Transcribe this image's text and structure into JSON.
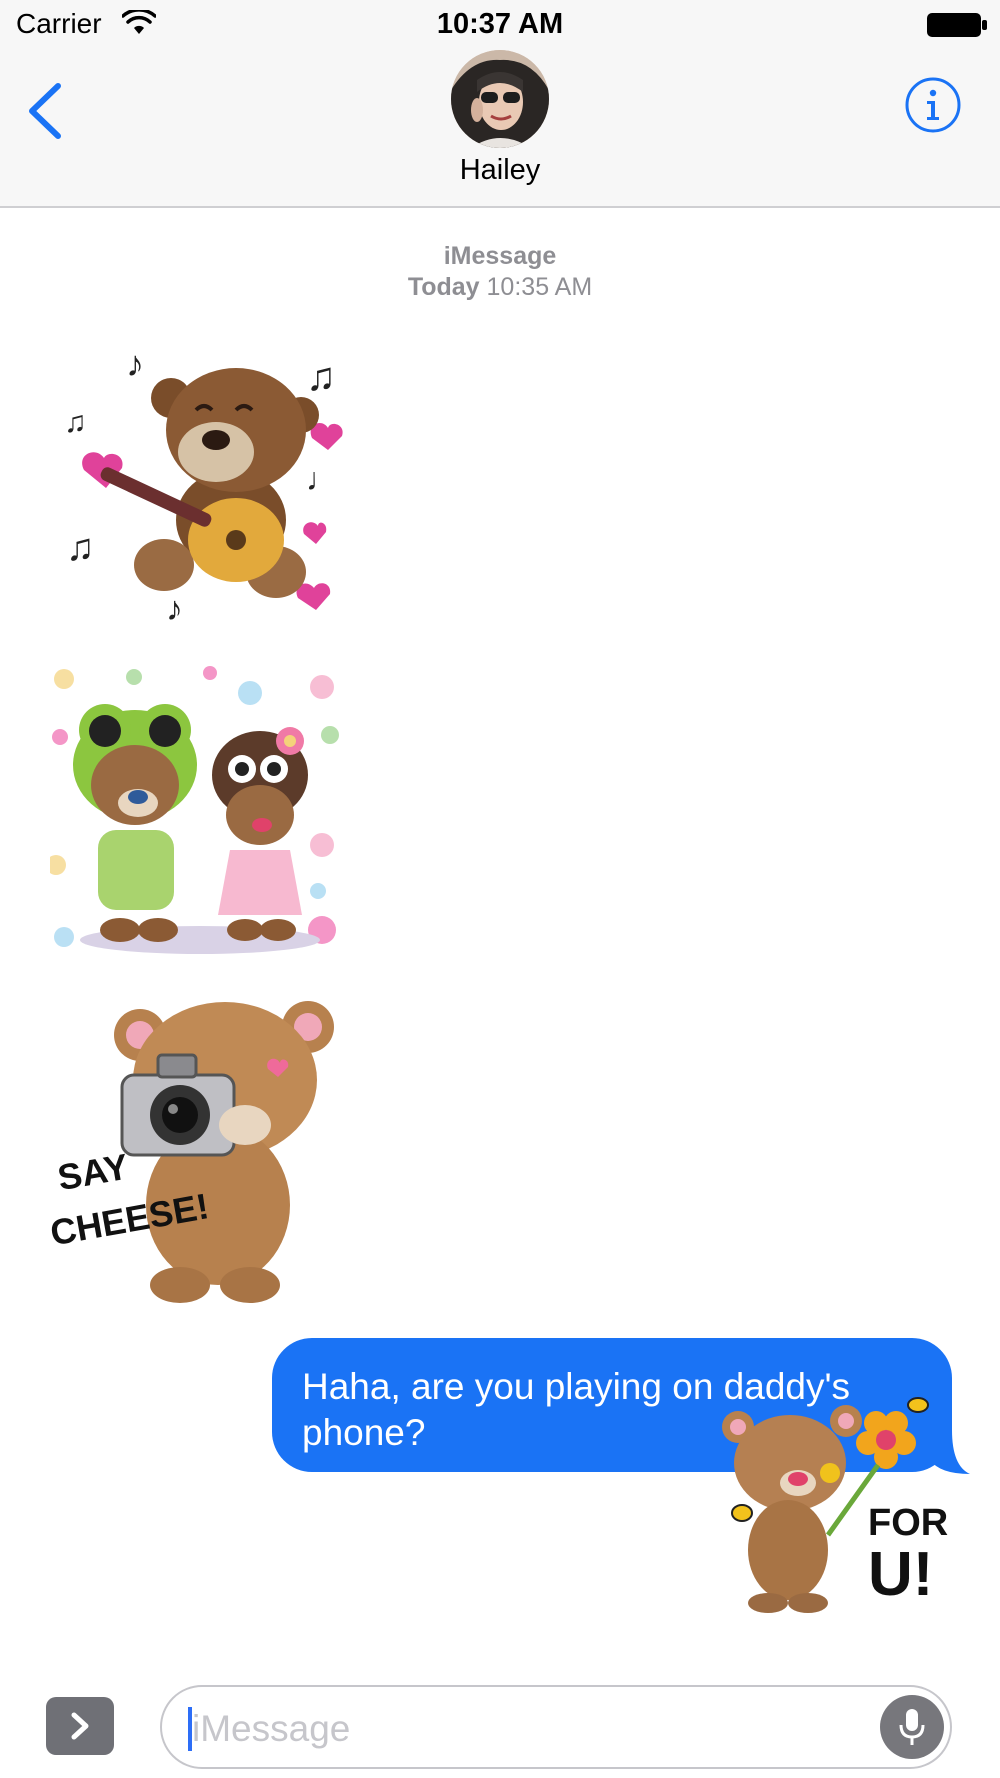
{
  "status_bar": {
    "carrier": "Carrier",
    "time": "10:37 AM",
    "icons": [
      "wifi-icon",
      "battery-icon"
    ]
  },
  "nav": {
    "contact_name": "Hailey",
    "icons": [
      "back-chevron-icon",
      "info-icon"
    ]
  },
  "thread": {
    "service": "iMessage",
    "day": "Today",
    "time": "10:35 AM"
  },
  "stickers": [
    {
      "name": "bear-guitar-sticker"
    },
    {
      "name": "bears-costume-sticker"
    },
    {
      "name": "bear-camera-sticker",
      "caption": "SAY CHEESE!"
    },
    {
      "name": "bear-flowers-sticker",
      "caption": "FOR U!"
    }
  ],
  "messages": [
    {
      "direction": "outgoing",
      "text": "Haha, are you playing on daddy's phone?"
    }
  ],
  "input": {
    "placeholder": "iMessage",
    "value": ""
  },
  "colors": {
    "accent": "#1a73f5",
    "bubble_outgoing": "#1a73f5",
    "nav_background": "#f7f7f7",
    "secondary_text": "#8e8e93"
  }
}
